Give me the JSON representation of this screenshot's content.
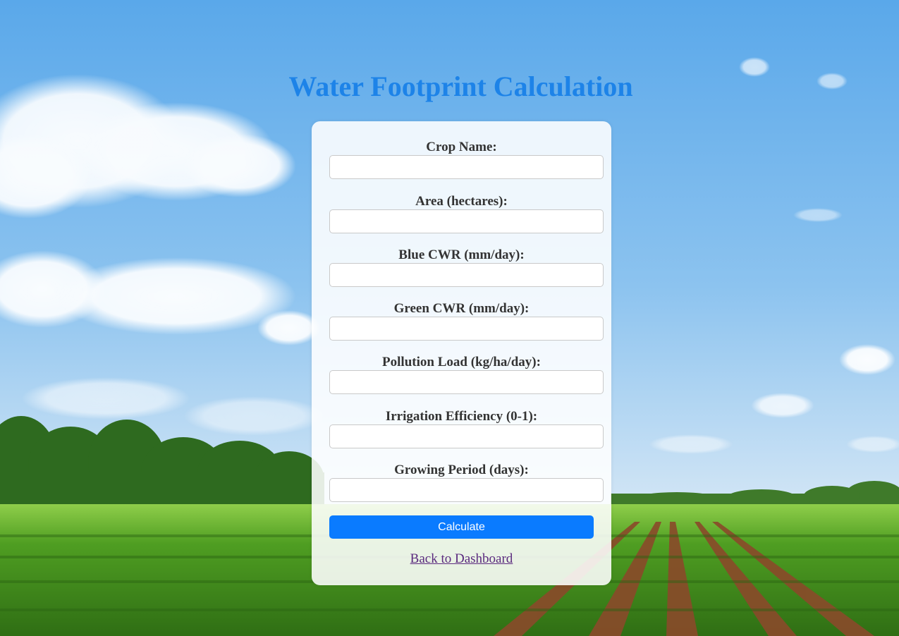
{
  "page": {
    "title": "Water Footprint Calculation"
  },
  "form": {
    "fields": [
      {
        "label": "Crop Name:",
        "value": "",
        "placeholder": ""
      },
      {
        "label": "Area (hectares):",
        "value": "",
        "placeholder": ""
      },
      {
        "label": "Blue CWR (mm/day):",
        "value": "",
        "placeholder": ""
      },
      {
        "label": "Green CWR (mm/day):",
        "value": "",
        "placeholder": ""
      },
      {
        "label": "Pollution Load (kg/ha/day):",
        "value": "",
        "placeholder": ""
      },
      {
        "label": "Irrigation Efficiency (0-1):",
        "value": "",
        "placeholder": ""
      },
      {
        "label": "Growing Period (days):",
        "value": "",
        "placeholder": ""
      }
    ],
    "submit_label": "Calculate",
    "back_link_label": "Back to Dashboard"
  },
  "colors": {
    "title": "#1d83e8",
    "button": "#0a7bff",
    "link": "#5a2a7e",
    "label": "#333333"
  }
}
